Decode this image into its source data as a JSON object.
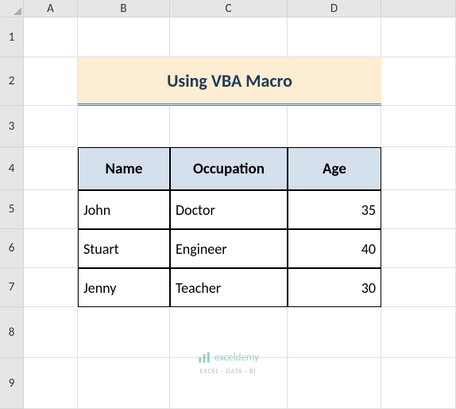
{
  "columns": [
    "A",
    "B",
    "C",
    "D"
  ],
  "rows": [
    "1",
    "2",
    "3",
    "4",
    "5",
    "6",
    "7",
    "8",
    "9"
  ],
  "title": "Using VBA Macro",
  "table": {
    "headers": [
      "Name",
      "Occupation",
      "Age"
    ],
    "rows": [
      {
        "name": "John",
        "occupation": "Doctor",
        "age": "35"
      },
      {
        "name": "Stuart",
        "occupation": "Engineer",
        "age": "40"
      },
      {
        "name": "Jenny",
        "occupation": "Teacher",
        "age": "30"
      }
    ]
  },
  "watermark": {
    "text": "exceldemy",
    "subtext": "EXCEL · DATA · BI"
  },
  "chart_data": {
    "type": "table",
    "title": "Using VBA Macro",
    "headers": [
      "Name",
      "Occupation",
      "Age"
    ],
    "data": [
      [
        "John",
        "Doctor",
        35
      ],
      [
        "Stuart",
        "Engineer",
        40
      ],
      [
        "Jenny",
        "Teacher",
        30
      ]
    ]
  }
}
